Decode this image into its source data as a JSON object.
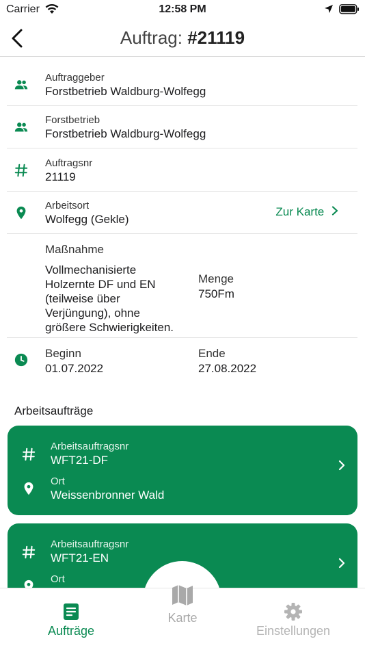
{
  "status": {
    "carrier": "Carrier",
    "time": "12:58 PM"
  },
  "nav": {
    "title_prefix": "Auftrag:",
    "title_number": "#21119"
  },
  "details": {
    "auftraggeber": {
      "label": "Auftraggeber",
      "value": "Forstbetrieb Waldburg-Wolfegg"
    },
    "forstbetrieb": {
      "label": "Forstbetrieb",
      "value": "Forstbetrieb Waldburg-Wolfegg"
    },
    "auftragsnr": {
      "label": "Auftragsnr",
      "value": "21119"
    },
    "arbeitsort": {
      "label": "Arbeitsort",
      "value": "Wolfegg (Gekle)",
      "link": "Zur Karte"
    },
    "massnahme": {
      "label": "Maßnahme",
      "lines": [
        "Vollmechanisierte",
        "Holzernte DF und EN",
        "(teilweise über",
        "Verjüngung),  ohne",
        "größere Schwierigkeiten."
      ],
      "menge_label": "Menge",
      "menge_value": "750Fm"
    },
    "zeitraum": {
      "beginn_label": "Beginn",
      "beginn_value": "01.07.2022",
      "ende_label": "Ende",
      "ende_value": "27.08.2022"
    }
  },
  "section_title": "Arbeitsaufträge",
  "cards": [
    {
      "nr_label": "Arbeitsauftragsnr",
      "nr_value": "WFT21-DF",
      "ort_label": "Ort",
      "ort_value": "Weissenbronner Wald"
    },
    {
      "nr_label": "Arbeitsauftragsnr",
      "nr_value": "WFT21-EN",
      "ort_label": "Ort",
      "ort_value": ""
    }
  ],
  "tabs": [
    {
      "label": "Aufträge",
      "active": true
    },
    {
      "label": "Karte",
      "active": false
    },
    {
      "label": "Einstellungen",
      "active": false
    }
  ],
  "colors": {
    "accent": "#0a8a52",
    "inactive": "#b0b0b0"
  }
}
